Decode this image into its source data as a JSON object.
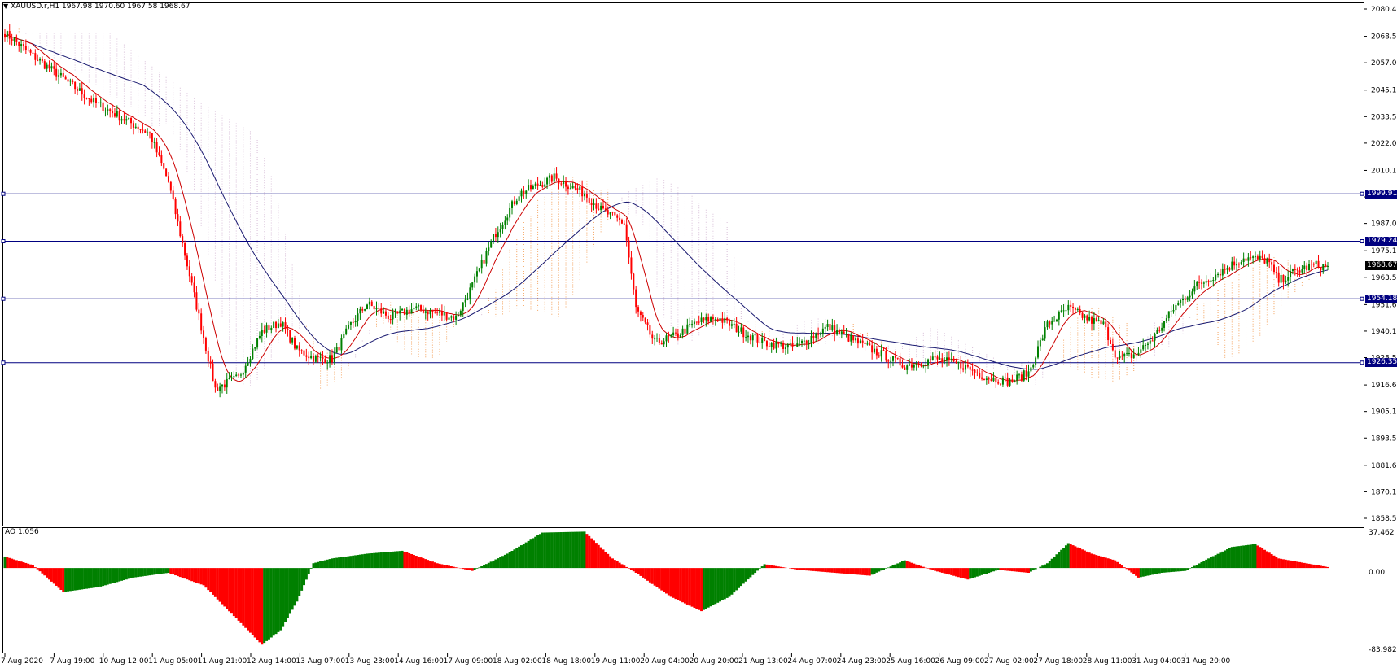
{
  "header": {
    "symbol_text": "XAUUSD.r,H1",
    "ohlc_text": "1967.98 1970.60 1967.58 1968.67"
  },
  "indicator": {
    "label": "AO 1.056",
    "scale_top": "37.462",
    "scale_zero": "0.00",
    "scale_bottom": "-83.982"
  },
  "colors": {
    "bull": "#008000",
    "bear": "#ff0000",
    "fast_ma": "#cc0000",
    "slow_ma": "#191970",
    "hline": "#000080",
    "cloud_up": "#f4a460",
    "cloud_dn": "#d8bfd8"
  },
  "chart_data": {
    "type": "candlestick",
    "price_axis": {
      "ylim": [
        1858.55,
        2080.45
      ],
      "ticks": [
        "2080.45",
        "2068.55",
        "2057.00",
        "2045.10",
        "2033.55",
        "2022.00",
        "2010.10",
        "1998.55",
        "1987.00",
        "1975.10",
        "1963.55",
        "1951.65",
        "1940.10",
        "1928.55",
        "1916.65",
        "1905.10",
        "1893.55",
        "1881.65",
        "1870.10",
        "1858.55"
      ]
    },
    "time_axis": {
      "labels": [
        "7 Aug 2020",
        "7 Aug 19:00",
        "10 Aug 12:00",
        "11 Aug 05:00",
        "11 Aug 21:00",
        "12 Aug 14:00",
        "13 Aug 07:00",
        "13 Aug 23:00",
        "14 Aug 16:00",
        "17 Aug 09:00",
        "18 Aug 02:00",
        "18 Aug 18:00",
        "19 Aug 11:00",
        "20 Aug 04:00",
        "20 Aug 20:00",
        "21 Aug 13:00",
        "24 Aug 07:00",
        "24 Aug 23:00",
        "25 Aug 16:00",
        "26 Aug 09:00",
        "27 Aug 02:00",
        "27 Aug 18:00",
        "28 Aug 11:00",
        "31 Aug 04:00",
        "31 Aug 20:00"
      ]
    },
    "horizontal_levels": [
      {
        "value": 1999.91,
        "label": "1999.91"
      },
      {
        "value": 1979.24,
        "label": "1979.24"
      },
      {
        "value": 1954.18,
        "label": "1954.18"
      },
      {
        "value": 1926.35,
        "label": "1926.35"
      }
    ],
    "current_price": {
      "value": 1968.67,
      "label": "1968.67"
    },
    "price_path_keyframes": [
      [
        0,
        2070
      ],
      [
        12,
        2060
      ],
      [
        25,
        2050
      ],
      [
        38,
        2040
      ],
      [
        50,
        2033
      ],
      [
        62,
        2026
      ],
      [
        70,
        2005
      ],
      [
        80,
        1960
      ],
      [
        90,
        1915
      ],
      [
        100,
        1920
      ],
      [
        110,
        1940
      ],
      [
        118,
        1944
      ],
      [
        125,
        1932
      ],
      [
        133,
        1928
      ],
      [
        140,
        1928
      ],
      [
        148,
        1943
      ],
      [
        155,
        1952
      ],
      [
        165,
        1946
      ],
      [
        175,
        1950
      ],
      [
        185,
        1948
      ],
      [
        193,
        1946
      ],
      [
        200,
        1960
      ],
      [
        210,
        1983
      ],
      [
        220,
        2000
      ],
      [
        235,
        2007
      ],
      [
        248,
        2000
      ],
      [
        255,
        1993
      ],
      [
        265,
        1987
      ],
      [
        270,
        1950
      ],
      [
        278,
        1935
      ],
      [
        287,
        1938
      ],
      [
        296,
        1944
      ],
      [
        305,
        1946
      ],
      [
        315,
        1940
      ],
      [
        325,
        1935
      ],
      [
        338,
        1933
      ],
      [
        352,
        1942
      ],
      [
        365,
        1935
      ],
      [
        375,
        1930
      ],
      [
        385,
        1925
      ],
      [
        398,
        1928
      ],
      [
        410,
        1925
      ],
      [
        420,
        1920
      ],
      [
        430,
        1918
      ],
      [
        438,
        1922
      ],
      [
        446,
        1943
      ],
      [
        455,
        1950
      ],
      [
        464,
        1945
      ],
      [
        470,
        1943
      ],
      [
        476,
        1928
      ],
      [
        484,
        1930
      ],
      [
        492,
        1938
      ],
      [
        500,
        1950
      ],
      [
        510,
        1960
      ],
      [
        520,
        1966
      ],
      [
        530,
        1972
      ],
      [
        540,
        1971
      ],
      [
        545,
        1962
      ],
      [
        552,
        1966
      ],
      [
        560,
        1969
      ],
      [
        566,
        1968
      ]
    ],
    "awesome_oscillator": {
      "ylim": [
        -83.982,
        37.462
      ],
      "keyframes": [
        [
          0,
          12
        ],
        [
          12,
          3
        ],
        [
          25,
          -25
        ],
        [
          40,
          -20
        ],
        [
          55,
          -10
        ],
        [
          70,
          -5
        ],
        [
          85,
          -18
        ],
        [
          100,
          -55
        ],
        [
          110,
          -80
        ],
        [
          118,
          -65
        ],
        [
          125,
          -35
        ],
        [
          132,
          5
        ],
        [
          140,
          10
        ],
        [
          155,
          15
        ],
        [
          170,
          18
        ],
        [
          185,
          5
        ],
        [
          200,
          -3
        ],
        [
          215,
          15
        ],
        [
          230,
          37
        ],
        [
          248,
          38
        ],
        [
          260,
          10
        ],
        [
          270,
          -5
        ],
        [
          285,
          -30
        ],
        [
          298,
          -45
        ],
        [
          310,
          -30
        ],
        [
          325,
          4
        ],
        [
          340,
          -2
        ],
        [
          355,
          -5
        ],
        [
          370,
          -8
        ],
        [
          385,
          8
        ],
        [
          398,
          -3
        ],
        [
          412,
          -12
        ],
        [
          425,
          -2
        ],
        [
          438,
          -5
        ],
        [
          446,
          5
        ],
        [
          455,
          26
        ],
        [
          465,
          15
        ],
        [
          475,
          8
        ],
        [
          485,
          -10
        ],
        [
          495,
          -5
        ],
        [
          505,
          -3
        ],
        [
          515,
          10
        ],
        [
          525,
          22
        ],
        [
          535,
          25
        ],
        [
          545,
          10
        ],
        [
          566,
          1
        ]
      ]
    }
  }
}
